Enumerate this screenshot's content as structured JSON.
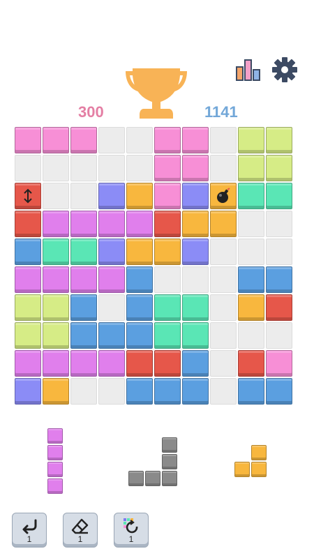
{
  "scores": {
    "current": "300",
    "best": "1141"
  },
  "colors": {
    "P": "#f78fd6",
    "G": "#d6ec86",
    "R": "#e6574a",
    "B": "#5b9fe0",
    "T": "#5ae6b5",
    "V": "#8b8cf6",
    "O": "#f8b73e",
    "M": "#e07fec",
    "E": "#ececec",
    "K": "#8a8a8a"
  },
  "board": [
    [
      "P",
      "P",
      "P",
      "E",
      "E",
      "P",
      "P",
      "E",
      "G",
      "G"
    ],
    [
      "E",
      "E",
      "E",
      "E",
      "E",
      "P",
      "P",
      "E",
      "G",
      "G"
    ],
    [
      "R",
      "E",
      "E",
      "V",
      "O",
      "P",
      "V",
      "O",
      "T",
      "T"
    ],
    [
      "R",
      "M",
      "M",
      "M",
      "M",
      "R",
      "O",
      "O",
      "E",
      "E"
    ],
    [
      "B",
      "T",
      "T",
      "V",
      "O",
      "O",
      "V",
      "E",
      "E",
      "E"
    ],
    [
      "M",
      "M",
      "M",
      "M",
      "B",
      "E",
      "E",
      "E",
      "B",
      "B"
    ],
    [
      "G",
      "G",
      "B",
      "E",
      "B",
      "T",
      "T",
      "E",
      "O",
      "R"
    ],
    [
      "G",
      "G",
      "B",
      "B",
      "B",
      "T",
      "T",
      "E",
      "E",
      "E"
    ],
    [
      "M",
      "M",
      "M",
      "M",
      "R",
      "R",
      "B",
      "E",
      "R",
      "P"
    ],
    [
      "V",
      "O",
      "E",
      "E",
      "B",
      "B",
      "B",
      "E",
      "B",
      "B"
    ]
  ],
  "special_cells": [
    {
      "row": 2,
      "col": 0,
      "icon": "vertical-arrows-icon"
    },
    {
      "row": 2,
      "col": 7,
      "icon": "bomb-icon"
    }
  ],
  "pieces": [
    {
      "name": "piece-vertical-bar",
      "color": "M",
      "cells": [
        [
          0,
          0
        ],
        [
          1,
          0
        ],
        [
          2,
          0
        ],
        [
          3,
          0
        ]
      ]
    },
    {
      "name": "piece-j-shape",
      "color": "K",
      "cells": [
        [
          0,
          2
        ],
        [
          1,
          2
        ],
        [
          2,
          0
        ],
        [
          2,
          1
        ],
        [
          2,
          2
        ]
      ]
    },
    {
      "name": "piece-l-small",
      "color": "O",
      "cells": [
        [
          0,
          1
        ],
        [
          1,
          0
        ],
        [
          1,
          1
        ]
      ]
    }
  ],
  "tools": [
    {
      "name": "undo-button",
      "icon": "undo-icon",
      "count": "1"
    },
    {
      "name": "eraser-button",
      "icon": "eraser-icon",
      "count": "1"
    },
    {
      "name": "refresh-pieces-button",
      "icon": "refresh-pieces-icon",
      "count": "1"
    }
  ],
  "header_icons": [
    "leaderboard-icon",
    "gear-icon",
    "trophy-icon"
  ]
}
